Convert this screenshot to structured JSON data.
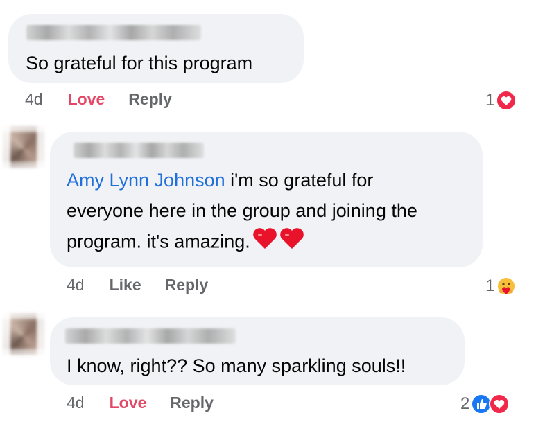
{
  "comments": [
    {
      "text": "So grateful for this program",
      "time": "4d",
      "action_react": "Love",
      "action_reply": "Reply",
      "reaction_count": "1",
      "reactions": [
        "heart-reaction-icon"
      ],
      "reaction_colors": {
        "heart": "#f0284a"
      }
    },
    {
      "mention": "Amy Lynn Johnson",
      "text_line1": " i'm so grateful for",
      "text_line2": "everyone here in the group and joining the",
      "text_line3": "program. it's amazing.",
      "time": "4d",
      "action_react": "Like",
      "action_reply": "Reply",
      "reaction_count": "1",
      "reactions": [
        "care-reaction-icon"
      ]
    },
    {
      "text": "I know, right?? So many sparkling souls!!",
      "time": "4d",
      "action_react": "Love",
      "action_reply": "Reply",
      "reaction_count": "2",
      "reactions": [
        "like-reaction-icon",
        "heart-reaction-icon"
      ],
      "reaction_colors": {
        "like": "#1877f2",
        "heart": "#f0284a"
      }
    }
  ],
  "colors": {
    "bubble": "#f0f2f5",
    "mention": "#216fdb",
    "love_action": "#e34765",
    "meta_text": "#65676b"
  }
}
